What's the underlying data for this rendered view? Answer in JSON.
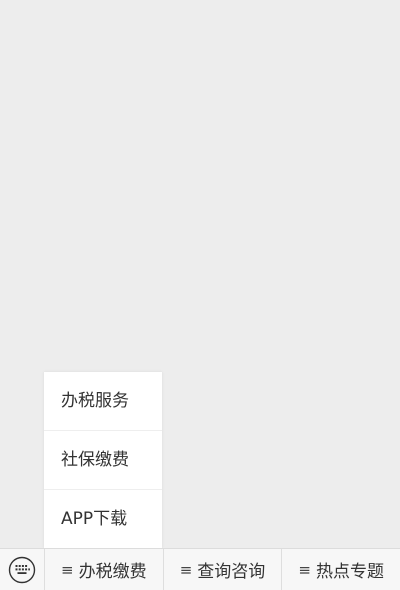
{
  "popup_menu": {
    "items": [
      {
        "label": "办税服务"
      },
      {
        "label": "社保缴费"
      },
      {
        "label": "APP下载"
      }
    ]
  },
  "menubar": {
    "keyboard_icon": "keyboard-icon",
    "tabs": [
      {
        "icon": "≡",
        "label": "办税缴费"
      },
      {
        "icon": "≡",
        "label": "查询咨询"
      },
      {
        "icon": "≡",
        "label": "热点专题"
      }
    ]
  },
  "colors": {
    "background": "#ededed",
    "menubar": "#f7f7f7",
    "popup": "#ffffff",
    "text": "#333333"
  }
}
